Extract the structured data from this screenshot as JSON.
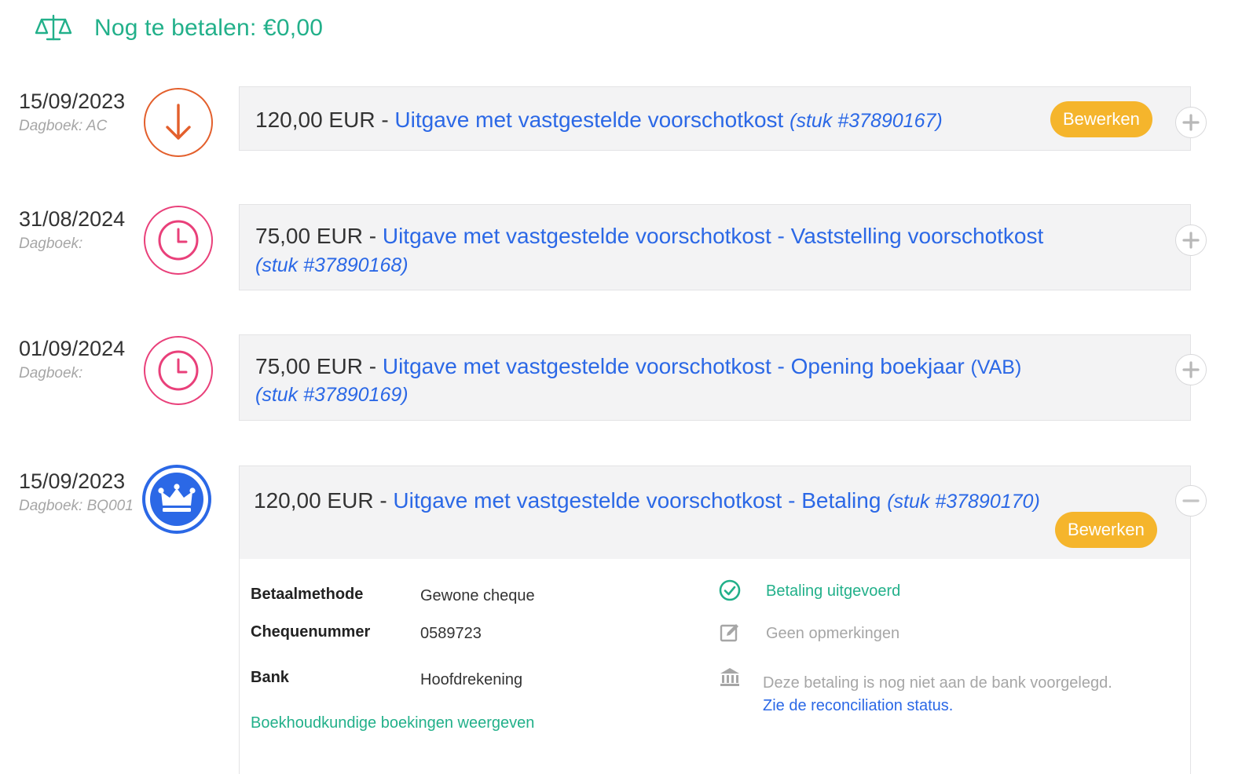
{
  "balance": {
    "label": "Nog te betalen: €0,00",
    "icon": "balance-scale-icon",
    "color": "#22b08a"
  },
  "entries": [
    {
      "date": "15/09/2023",
      "journal": "Dagboek: AC",
      "icon": "arrow-down-icon",
      "amount": "120,00 EUR -",
      "description": "Uitgave met vastgestelde voorschotkost",
      "reference": "(stuk #37890167)",
      "edit_label": "Bewerken",
      "toggle": "plus-icon"
    },
    {
      "date": "31/08/2024",
      "journal": "Dagboek:",
      "icon": "clock-icon",
      "amount": "75,00 EUR -",
      "description": "Uitgave met vastgestelde voorschotkost - Vaststelling voorschotkost",
      "reference": "(stuk #37890168)",
      "toggle": "plus-icon"
    },
    {
      "date": "01/09/2024",
      "journal": "Dagboek:",
      "icon": "clock-icon",
      "amount": "75,00 EUR -",
      "description": "Uitgave met vastgestelde voorschotkost - Opening boekjaar",
      "extra": "(VAB)",
      "reference": "(stuk #37890169)",
      "toggle": "plus-icon"
    },
    {
      "date": "15/09/2023",
      "journal": "Dagboek: BQ001",
      "icon": "crown-icon",
      "amount": "120,00 EUR -",
      "description": "Uitgave met vastgestelde voorschotkost - Betaling",
      "reference": "(stuk #37890170)",
      "edit_label": "Bewerken",
      "toggle": "minus-icon"
    }
  ],
  "payment_details": {
    "method_label": "Betaalmethode",
    "method_value": "Gewone cheque",
    "cheque_label": "Chequenummer",
    "cheque_value": "0589723",
    "bank_label": "Bank",
    "bank_value": "Hoofdrekening",
    "entries_link": "Boekhoudkundige boekingen weergeven",
    "status_text": "Betaling uitgevoerd",
    "remarks_text": "Geen opmerkingen",
    "bank_note": "Deze betaling is nog niet aan de bank voorgelegd.",
    "reconciliation_link": "Zie de reconciliation status."
  },
  "colors": {
    "accent_green": "#22b08a",
    "link_blue": "#2b68e6",
    "button_yellow": "#f5b52c",
    "expense_orange": "#e35f2c",
    "pending_pink": "#e9407a"
  }
}
